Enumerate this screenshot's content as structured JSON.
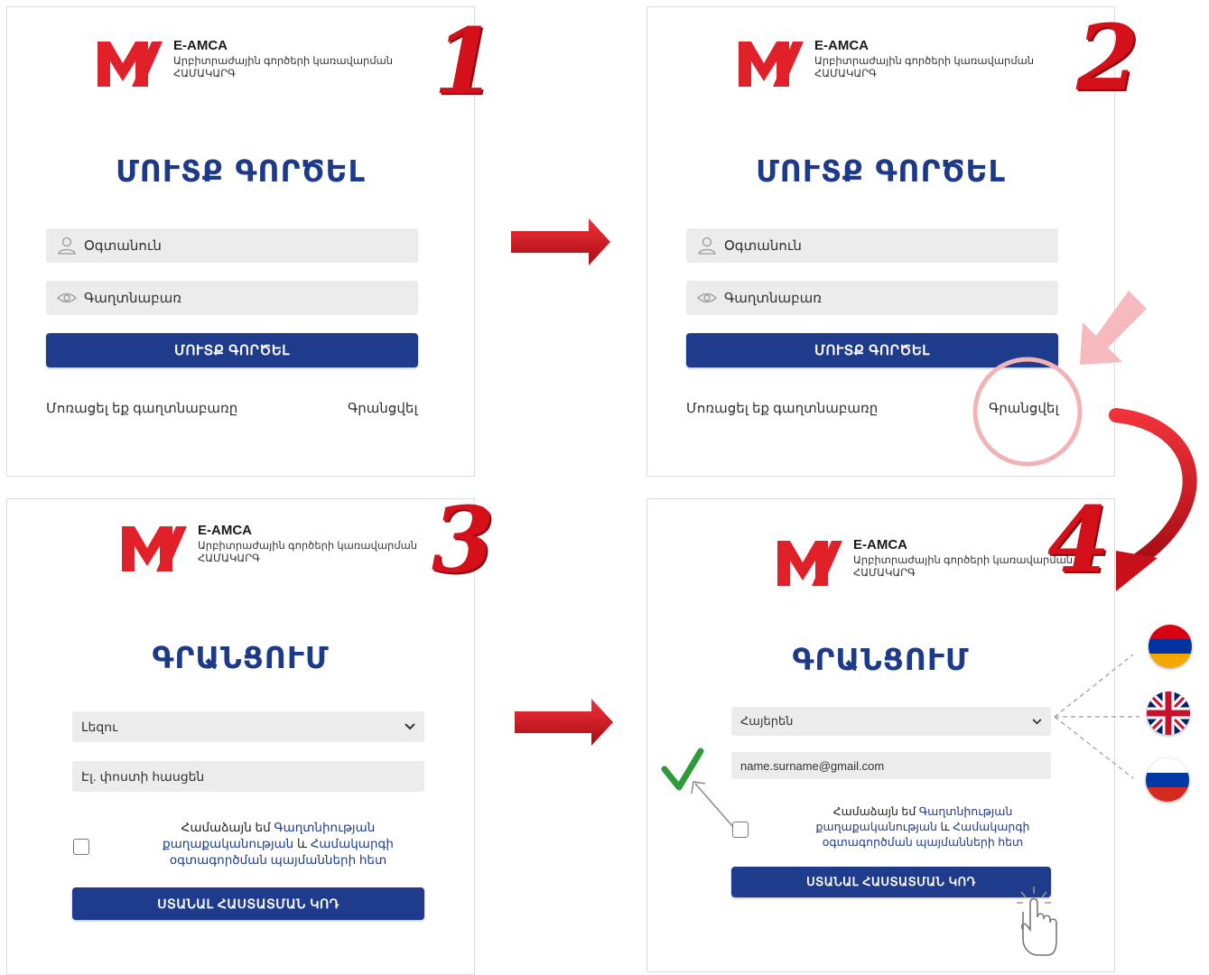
{
  "logo": {
    "brand": "E-AMCA",
    "subtitle_line1": "Արբիտրաժային գործերի կառավարման",
    "subtitle_line2": "ՀԱՄԱԿԱՐԳ"
  },
  "panel1": {
    "step": "1",
    "title": "ՄՈՒՏՔ ԳՈՐԾԵԼ",
    "username_placeholder": "Օգտանուն",
    "password_placeholder": "Գաղտնաբառ",
    "login_button": "ՄՈՒՏՔ ԳՈՐԾԵԼ",
    "forgot_link": "Մոռացել եք գաղտնաբառը",
    "register_link": "Գրանցվել"
  },
  "panel2": {
    "step": "2",
    "title": "ՄՈՒՏՔ ԳՈՐԾԵԼ",
    "username_placeholder": "Օգտանուն",
    "password_placeholder": "Գաղտնաբառ",
    "login_button": "ՄՈՒՏՔ ԳՈՐԾԵԼ",
    "forgot_link": "Մոռացել եք գաղտնաբառը",
    "register_link": "Գրանցվել"
  },
  "panel3": {
    "step": "3",
    "title": "ԳՐԱՆՑՈՒՄ",
    "language_select": "Լեզու",
    "email_placeholder": "Էլ. փոստի հասցեն",
    "consent_line1": "Համաձայն եմ",
    "consent_link1": "Գաղտնիության",
    "consent_link2": "քաղաքականության",
    "consent_and": "և",
    "consent_link3": "Համակարգի",
    "consent_line3": "օգտագործման պայմանների հետ",
    "submit_button": "ՍՏԱՆԱԼ ՀԱՍՏԱՏՄԱՆ ԿՈԴ"
  },
  "panel4": {
    "step": "4",
    "title": "ԳՐԱՆՑՈՒՄ",
    "language_select": "Հայերեն",
    "email_value": "name.surname@gmail.com",
    "consent_line1": "Համաձայն եմ",
    "consent_link1": "Գաղտնիության",
    "consent_link2": "քաղաքականության",
    "consent_and": "և",
    "consent_link3": "Համակարգի",
    "consent_line3": "օգտագործման պայմանների հետ",
    "submit_button": "ՍՏԱՆԱԼ ՀԱՍՏԱՏՄԱՆ ԿՈԴ"
  },
  "flags": [
    "armenia-flag",
    "uk-flag",
    "russia-flag"
  ],
  "colors": {
    "brand_blue": "#1f3c8c",
    "accent_red": "#d4101a",
    "field_gray": "#ececec",
    "check_green": "#2e9a3a"
  }
}
